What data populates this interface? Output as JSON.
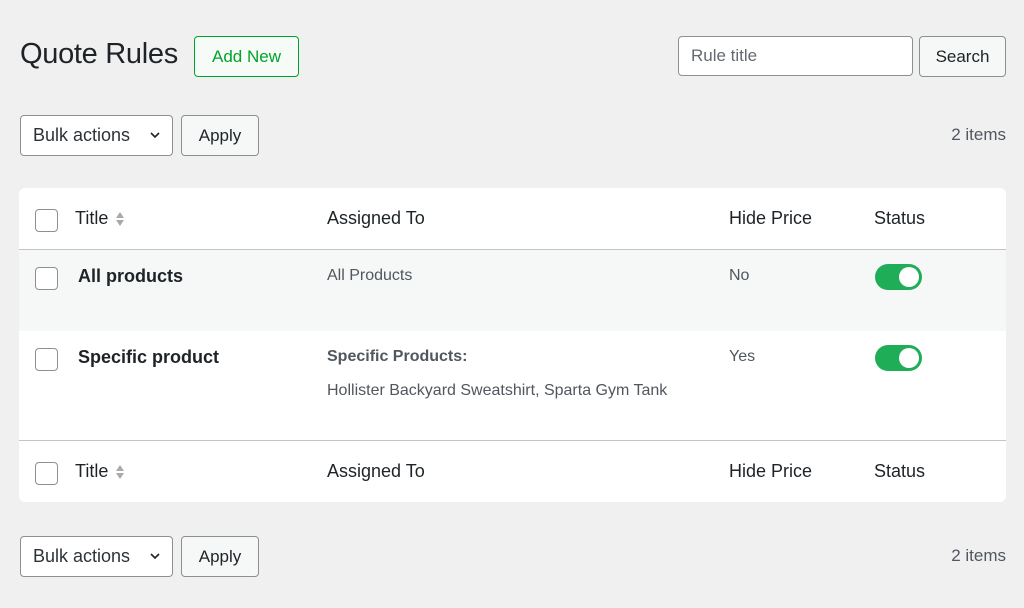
{
  "header": {
    "title": "Quote Rules",
    "add_new_label": "Add New",
    "search_placeholder": "Rule title",
    "search_label": "Search"
  },
  "tablenav_top": {
    "bulk_actions_label": "Bulk actions",
    "apply_label": "Apply",
    "items_count": "2 items"
  },
  "tablenav_bottom": {
    "bulk_actions_label": "Bulk actions",
    "apply_label": "Apply",
    "items_count": "2 items"
  },
  "table": {
    "columns": {
      "title": "Title",
      "assigned_to": "Assigned To",
      "hide_price": "Hide Price",
      "status": "Status"
    },
    "rows": [
      {
        "title": "All products",
        "assigned_to": "All Products",
        "hide_price": "No",
        "status_enabled": true
      },
      {
        "title": "Specific product",
        "assigned_label": "Specific Products:",
        "assigned_products": "Hollister Backyard Sweatshirt, Sparta Gym Tank",
        "hide_price": "Yes",
        "status_enabled": true
      }
    ]
  },
  "colors": {
    "accent_green": "#00a32a",
    "toggle_on": "#1fae57",
    "background": "#f0f0f1"
  }
}
